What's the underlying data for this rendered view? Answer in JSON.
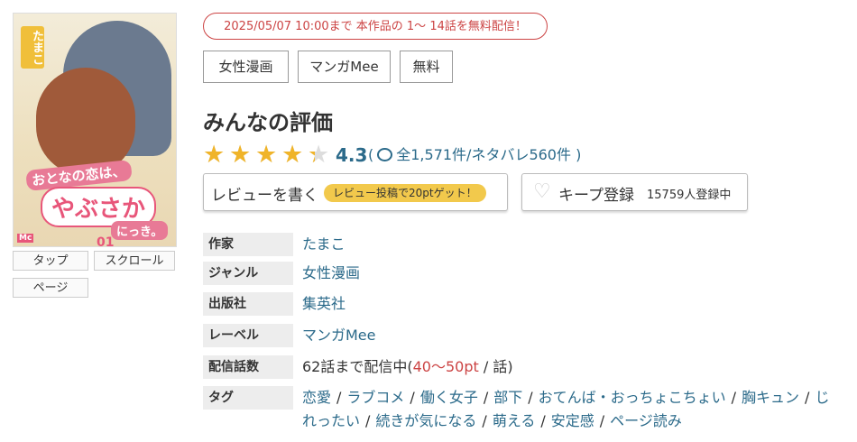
{
  "cover": {
    "author_vertical": "たまこ",
    "title_line1": "おとなの恋は、",
    "title_line2": "やぶさか",
    "title_line3": "にっき。",
    "volume": "01",
    "publisher_mark": "Mc"
  },
  "viewer_buttons": [
    "タップ",
    "スクロール",
    "ページ"
  ],
  "free_notice": "2025/05/07 10:00まで 本作品の 1～ 14話を無料配信！",
  "tag_buttons": [
    "女性漫画",
    "マンガMee",
    "無料"
  ],
  "rating": {
    "heading": "みんなの評価",
    "score": "4.3",
    "stars_value": 4.3,
    "stars_max": 5,
    "count_open": "(",
    "count_text": "全1,571件/ネタバレ560件",
    "count_close": ")"
  },
  "review_button": {
    "label": "レビューを書く",
    "badge": "レビュー投稿で20ptゲット！"
  },
  "keep_button": {
    "label": "キープ登録",
    "count": "15759人登録中"
  },
  "info": {
    "author_label": "作家",
    "author": "たまこ",
    "genre_label": "ジャンル",
    "genre": "女性漫画",
    "publisher_label": "出版社",
    "publisher": "集英社",
    "label_label": "レーベル",
    "label": "マンガMee",
    "episodes_label": "配信話数",
    "episodes_prefix": "62話まで配信中(",
    "episodes_price": "40〜50pt",
    "episodes_suffix": " / 話)",
    "tags_label": "タグ",
    "tags": [
      "恋愛",
      "ラブコメ",
      "働く女子",
      "部下",
      "おてんば・おっちょこちょい",
      "胸キュン",
      "じれったい",
      "続きが気になる",
      "萌える",
      "安定感",
      "ページ読み"
    ]
  },
  "colors": {
    "accent_red": "#cc4444",
    "link_blue": "#2b6a8a",
    "star_gold": "#f0b429",
    "badge_yellow": "#f2c94c"
  }
}
